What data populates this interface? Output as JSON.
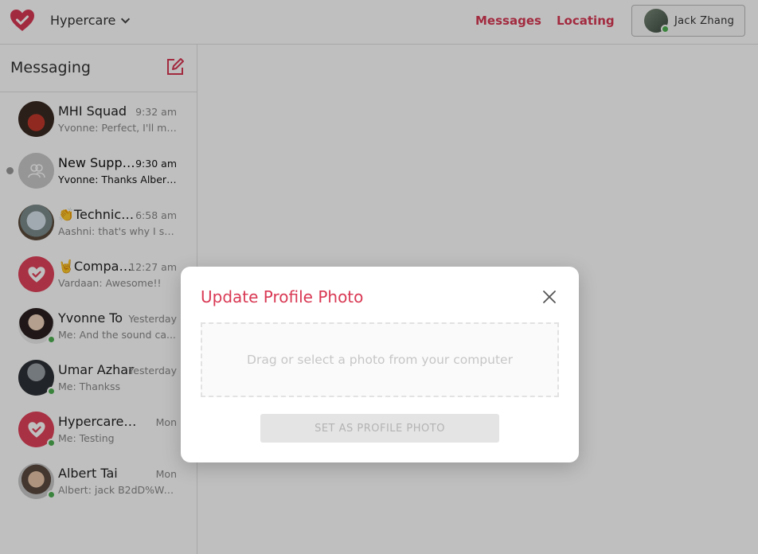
{
  "header": {
    "org_name": "Hypercare",
    "nav": [
      {
        "label": "Messages"
      },
      {
        "label": "Locating"
      }
    ],
    "user_name": "Jack Zhang",
    "brand_color": "#d93954"
  },
  "sidebar": {
    "title": "Messaging",
    "chats": [
      {
        "name": "MHI Squad",
        "time": "9:32 am",
        "preview": "Yvonne: Perfect, I'll me..."
      },
      {
        "name": "New Suppo...",
        "time": "9:30 am",
        "preview": "Yvonne: Thanks Albert,...",
        "unread": true
      },
      {
        "name": "👏Technica...",
        "time": "6:58 am",
        "preview": "Aashni: that's why I sai..."
      },
      {
        "name": "🤘Compan...",
        "time": "12:27 am",
        "preview": "Vardaan: Awesome!!"
      },
      {
        "name": "Yvonne To",
        "time": "Yesterday",
        "preview": "Me: And the sound ca...",
        "online": true
      },
      {
        "name": "Umar Azhar",
        "time": "Yesterday",
        "preview": "Me: Thankss",
        "online": true
      },
      {
        "name": "Hypercare ❓S...",
        "time": "Mon",
        "preview": "Me: Testing",
        "online": true
      },
      {
        "name": "Albert Tai",
        "time": "Mon",
        "preview": "Albert: jack B2dD%Wa&",
        "online": true
      }
    ]
  },
  "modal": {
    "title": "Update Profile Photo",
    "dropzone_text": "Drag or select a photo from your computer",
    "submit_label": "SET AS PROFILE PHOTO"
  }
}
